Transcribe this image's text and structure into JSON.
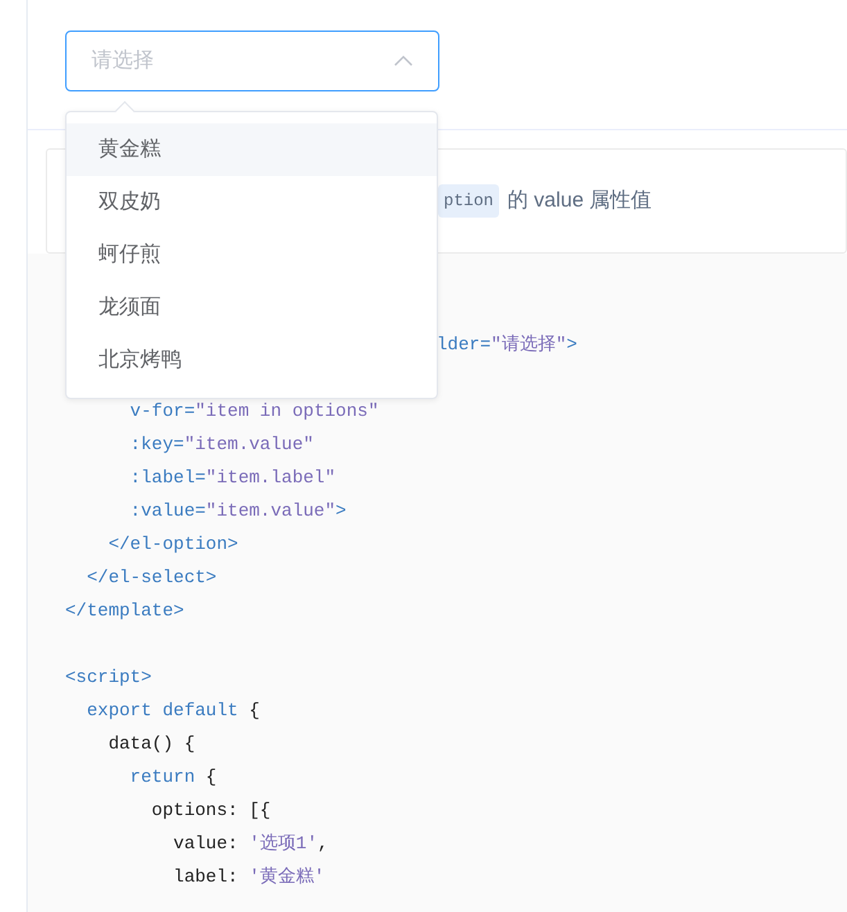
{
  "select": {
    "placeholder": "请选择",
    "open": true
  },
  "dropdown": {
    "options": [
      {
        "label": "黄金糕",
        "hovered": true
      },
      {
        "label": "双皮奶",
        "hovered": false
      },
      {
        "label": "蚵仔煎",
        "hovered": false
      },
      {
        "label": "龙须面",
        "hovered": false
      },
      {
        "label": "北京烤鸭",
        "hovered": false
      }
    ]
  },
  "description": {
    "code_chip": "ption",
    "text": "的 value 属性值"
  },
  "code_lines": [
    {
      "kind": "code",
      "tokens": [
        {
          "kind": "tag",
          "text": "lder="
        },
        {
          "kind": "string",
          "text": "\"请选择\""
        },
        {
          "kind": "tag",
          "text": ">"
        }
      ]
    },
    {
      "kind": "blank"
    },
    {
      "kind": "code",
      "tokens": [
        {
          "kind": "tag",
          "text": "      v-for="
        },
        {
          "kind": "string",
          "text": "\"item in options\""
        }
      ]
    },
    {
      "kind": "code",
      "tokens": [
        {
          "kind": "tag",
          "text": "      :key="
        },
        {
          "kind": "string",
          "text": "\"item.value\""
        }
      ]
    },
    {
      "kind": "code",
      "tokens": [
        {
          "kind": "tag",
          "text": "      :label="
        },
        {
          "kind": "string",
          "text": "\"item.label\""
        }
      ]
    },
    {
      "kind": "code",
      "tokens": [
        {
          "kind": "tag",
          "text": "      :value="
        },
        {
          "kind": "string",
          "text": "\"item.value\""
        },
        {
          "kind": "tag",
          "text": ">"
        }
      ]
    },
    {
      "kind": "code",
      "tokens": [
        {
          "kind": "tag",
          "text": "    </el-option>"
        }
      ]
    },
    {
      "kind": "code",
      "tokens": [
        {
          "kind": "tag",
          "text": "  </el-select>"
        }
      ]
    },
    {
      "kind": "code",
      "tokens": [
        {
          "kind": "tag",
          "text": "</template>"
        }
      ]
    },
    {
      "kind": "blank"
    },
    {
      "kind": "code",
      "tokens": [
        {
          "kind": "tag",
          "text": "<script>"
        }
      ]
    },
    {
      "kind": "code",
      "tokens": [
        {
          "kind": "tag",
          "text": "  export default "
        },
        {
          "kind": "plain",
          "text": "{"
        }
      ]
    },
    {
      "kind": "code",
      "tokens": [
        {
          "kind": "plain",
          "text": "    data() {"
        }
      ]
    },
    {
      "kind": "code",
      "tokens": [
        {
          "kind": "tag",
          "text": "      return "
        },
        {
          "kind": "plain",
          "text": "{"
        }
      ]
    },
    {
      "kind": "code",
      "tokens": [
        {
          "kind": "plain",
          "text": "        options: [{"
        }
      ]
    },
    {
      "kind": "code",
      "tokens": [
        {
          "kind": "plain",
          "text": "          value: "
        },
        {
          "kind": "string",
          "text": "'选项1'"
        },
        {
          "kind": "plain",
          "text": ","
        }
      ]
    },
    {
      "kind": "code",
      "tokens": [
        {
          "kind": "plain",
          "text": "          label: "
        },
        {
          "kind": "string",
          "text": "'黄金糕'"
        }
      ]
    }
  ]
}
